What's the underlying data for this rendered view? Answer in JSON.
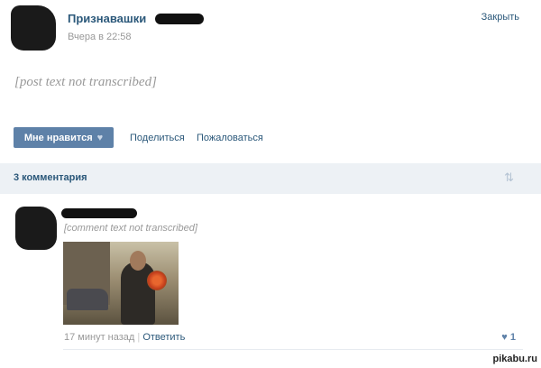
{
  "post": {
    "author": "Признавашки",
    "time": "Вчера в 22:58",
    "close_label": "Закрыть",
    "text": "[post text not transcribed]",
    "like_label": "Мне нравится",
    "share_label": "Поделиться",
    "report_label": "Пожаловаться"
  },
  "comments": {
    "count_label": "3 комментария",
    "item": {
      "text": "[comment text not transcribed]",
      "time": "17 минут назад",
      "separator": "|",
      "reply_label": "Ответить",
      "likes": "1"
    }
  },
  "watermark": "pikabu.ru"
}
